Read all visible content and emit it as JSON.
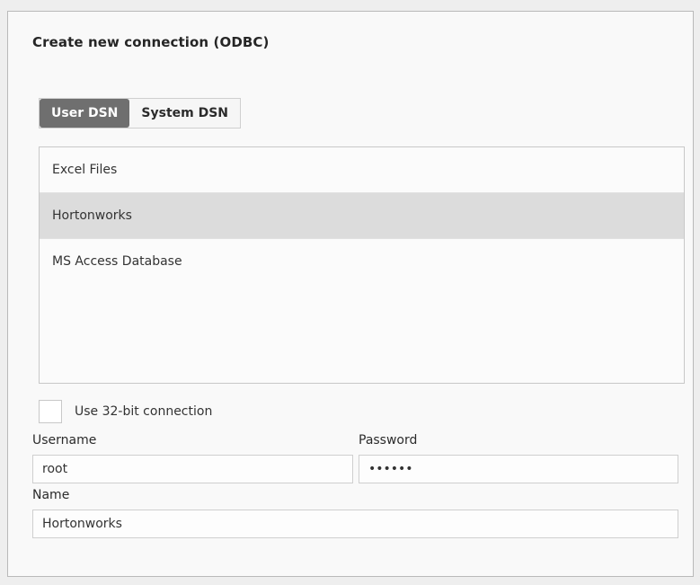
{
  "dialog": {
    "title": "Create new connection (ODBC)"
  },
  "tabs": [
    {
      "label": "User DSN",
      "active": true
    },
    {
      "label": "System DSN",
      "active": false
    }
  ],
  "dsn_list": {
    "items": [
      {
        "label": "Excel Files",
        "selected": false
      },
      {
        "label": "Hortonworks",
        "selected": true
      },
      {
        "label": "MS Access Database",
        "selected": false
      }
    ]
  },
  "options": {
    "use_32bit_label": "Use 32-bit connection",
    "use_32bit_checked": false
  },
  "form": {
    "username_label": "Username",
    "username_value": "root",
    "password_label": "Password",
    "password_value": "••••••",
    "name_label": "Name",
    "name_value": "Hortonworks"
  },
  "colors": {
    "active_tab": "#6f6f6f",
    "selected_row": "#dcdcdc"
  }
}
